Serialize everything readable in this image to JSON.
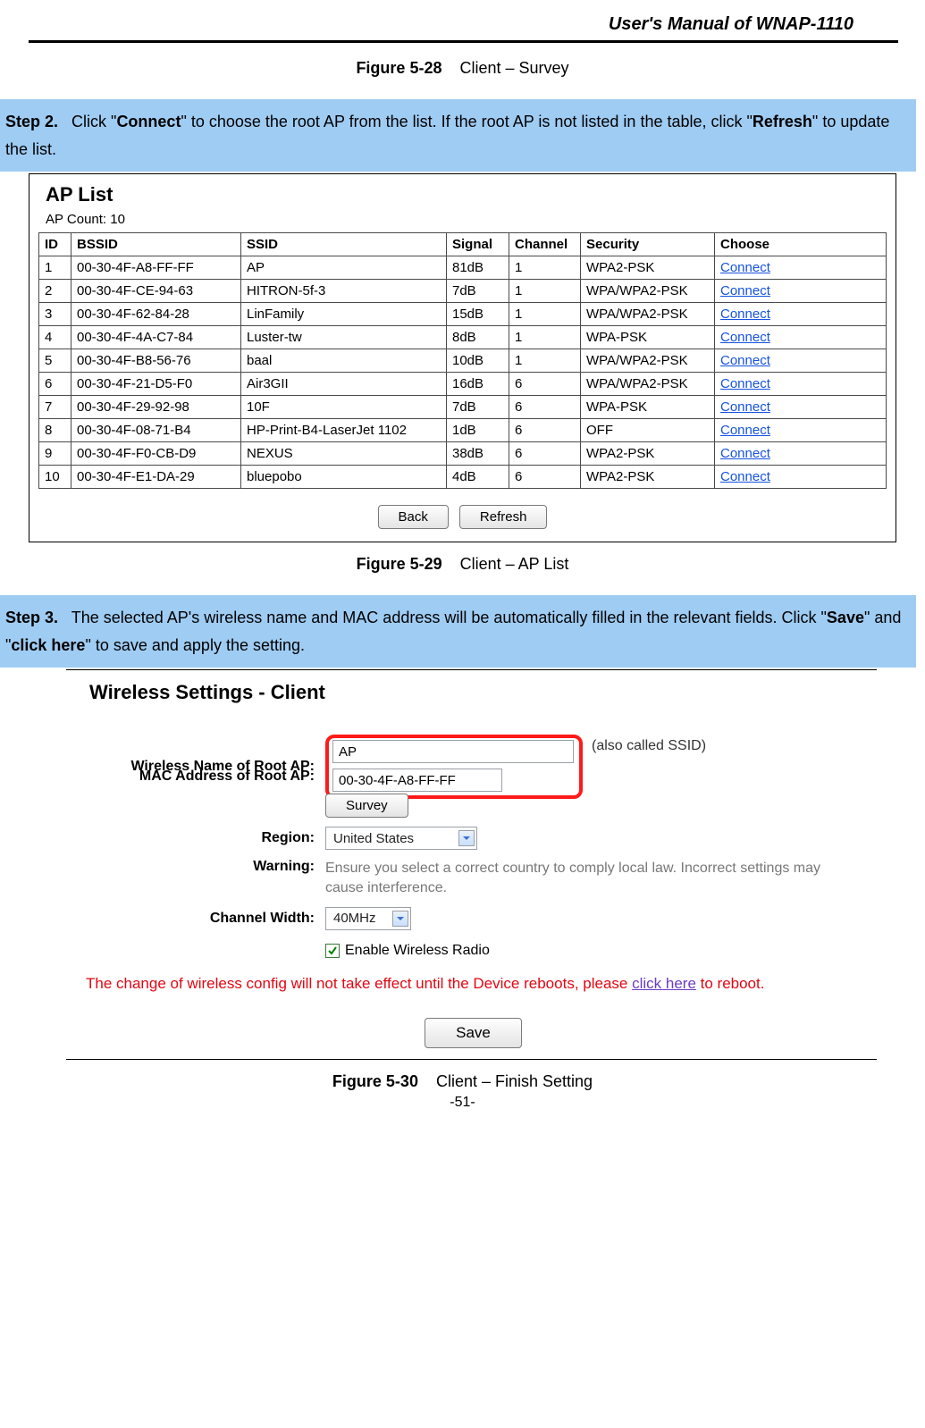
{
  "header": {
    "title": "User's  Manual  of  WNAP-1110"
  },
  "figure28": {
    "number": "Figure 5-28",
    "label": "Client – Survey"
  },
  "step2": {
    "label": "Step 2.",
    "text_a": "Click \"",
    "strong_a": "Connect",
    "text_b": "\" to choose the root AP from the list. If the root AP is not listed in the table, click \"",
    "strong_b": "Refresh",
    "text_c": "\" to update the list."
  },
  "aplist": {
    "title": "AP List",
    "count_label": "AP Count: 10",
    "headers": [
      "ID",
      "BSSID",
      "SSID",
      "Signal",
      "Channel",
      "Security",
      "Choose"
    ],
    "rows": [
      {
        "id": "1",
        "bssid": "00-30-4F-A8-FF-FF",
        "ssid": "AP",
        "signal": "81dB",
        "channel": "1",
        "security": "WPA2-PSK",
        "choose": "Connect"
      },
      {
        "id": "2",
        "bssid": "00-30-4F-CE-94-63",
        "ssid": "HITRON-5f-3",
        "signal": "7dB",
        "channel": "1",
        "security": "WPA/WPA2-PSK",
        "choose": "Connect"
      },
      {
        "id": "3",
        "bssid": "00-30-4F-62-84-28",
        "ssid": "LinFamily",
        "signal": "15dB",
        "channel": "1",
        "security": "WPA/WPA2-PSK",
        "choose": "Connect"
      },
      {
        "id": "4",
        "bssid": "00-30-4F-4A-C7-84",
        "ssid": "Luster-tw",
        "signal": "8dB",
        "channel": "1",
        "security": "WPA-PSK",
        "choose": "Connect"
      },
      {
        "id": "5",
        "bssid": "00-30-4F-B8-56-76",
        "ssid": "baal",
        "signal": "10dB",
        "channel": "1",
        "security": "WPA/WPA2-PSK",
        "choose": "Connect"
      },
      {
        "id": "6",
        "bssid": "00-30-4F-21-D5-F0",
        "ssid": "Air3GII",
        "signal": "16dB",
        "channel": "6",
        "security": "WPA/WPA2-PSK",
        "choose": "Connect"
      },
      {
        "id": "7",
        "bssid": "00-30-4F-29-92-98",
        "ssid": "10F",
        "signal": "7dB",
        "channel": "6",
        "security": "WPA-PSK",
        "choose": "Connect"
      },
      {
        "id": "8",
        "bssid": "00-30-4F-08-71-B4",
        "ssid": "HP-Print-B4-LaserJet 1102",
        "signal": "1dB",
        "channel": "6",
        "security": "OFF",
        "choose": "Connect"
      },
      {
        "id": "9",
        "bssid": "00-30-4F-F0-CB-D9",
        "ssid": "NEXUS",
        "signal": "38dB",
        "channel": "6",
        "security": "WPA2-PSK",
        "choose": "Connect"
      },
      {
        "id": "10",
        "bssid": "00-30-4F-E1-DA-29",
        "ssid": "bluepobo",
        "signal": "4dB",
        "channel": "6",
        "security": "WPA2-PSK",
        "choose": "Connect"
      }
    ],
    "buttons": {
      "back": "Back",
      "refresh": "Refresh"
    }
  },
  "figure29": {
    "number": "Figure 5-29",
    "label": "Client – AP List"
  },
  "step3": {
    "label": "Step 3.",
    "text_a": "The selected AP's wireless name and MAC address will be automatically filled in the relevant fields. Click \"",
    "strong_a": "Save",
    "text_b": "\" and \"",
    "strong_b": "click here",
    "text_c": "\" to save and apply the setting."
  },
  "settings": {
    "title": "Wireless Settings - Client",
    "labels": {
      "wireless_name": "Wireless Name of Root AP:",
      "mac": "MAC Address of Root AP:",
      "region": "Region:",
      "warning": "Warning:",
      "channel_width": "Channel Width:"
    },
    "values": {
      "ssid": "AP",
      "mac": "00-30-4F-A8-FF-FF",
      "ssid_note": "(also called SSID)",
      "survey": "Survey",
      "region": "United States",
      "warning_text": "Ensure you select a correct country to comply local law. Incorrect settings may cause interference.",
      "channel_width": "40MHz",
      "enable_radio": "Enable Wireless Radio",
      "reboot_a": "The change of wireless config will not take effect until the Device reboots, please ",
      "reboot_link": "click here",
      "reboot_b": " to reboot.",
      "save": "Save"
    }
  },
  "figure30": {
    "number": "Figure 5-30",
    "label": "Client – Finish Setting"
  },
  "page_number": "-51-"
}
